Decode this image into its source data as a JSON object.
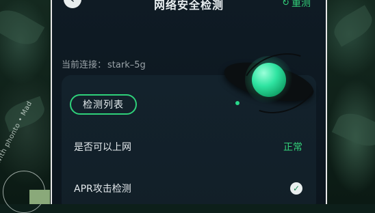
{
  "header": {
    "title": "网络安全检测",
    "back_icon": "chevron-left-icon",
    "redetect_label": "重测",
    "redetect_icon": "refresh-icon"
  },
  "connection": {
    "label": "当前连接：",
    "ssid": "stark–5g"
  },
  "card": {
    "list_tag": "检测列表",
    "items": [
      {
        "label": "是否可以上网",
        "status": "正常"
      },
      {
        "label": "APR攻击检测",
        "status_icon": "checkmark-icon"
      }
    ]
  },
  "watermark": {
    "text": "with phonto • Mad"
  },
  "colors": {
    "accent": "#33d17a",
    "panel": "#13222c",
    "background": "#0f1b24"
  }
}
